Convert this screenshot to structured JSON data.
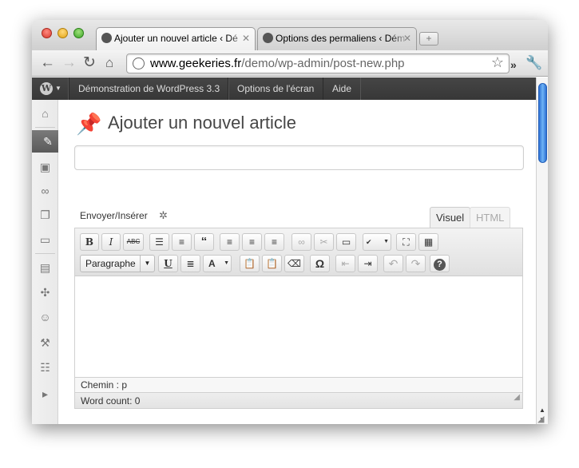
{
  "browser": {
    "tabs": [
      {
        "label": "Ajouter un nouvel article ‹ Dé",
        "active": true
      },
      {
        "label": "Options des permaliens ‹ Dém",
        "active": false
      }
    ],
    "url_domain": "www.geekeries.fr",
    "url_path": "/demo/wp-admin/post-new.php"
  },
  "adminbar": {
    "site": "Démonstration de WordPress 3.3",
    "screen_options": "Options de l'écran",
    "help": "Aide"
  },
  "page": {
    "title": "Ajouter un nouvel article",
    "title_value": "",
    "upload_insert": "Envoyer/Insérer",
    "tab_visual": "Visuel",
    "tab_html": "HTML",
    "format_select": "Paragraphe",
    "path_text": "Chemin : p",
    "word_count": "Word count: 0"
  },
  "colors": {
    "adminbar": "#3b3b3b",
    "scrollbar_thumb": "#4a90e2",
    "menu_active": "#6a6a6a"
  }
}
